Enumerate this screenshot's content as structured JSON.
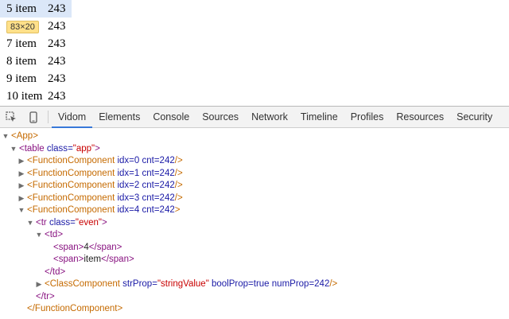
{
  "page": {
    "rows": [
      {
        "label": "5 item",
        "value": "243",
        "highlight": true
      },
      {
        "label": "83×20",
        "value": "243",
        "badge": true
      },
      {
        "label": "7 item",
        "value": "243"
      },
      {
        "label": "8 item",
        "value": "243"
      },
      {
        "label": "9 item",
        "value": "243"
      },
      {
        "label": "10 item",
        "value": "243"
      }
    ]
  },
  "devtools": {
    "tabs": [
      "Vidom",
      "Elements",
      "Console",
      "Sources",
      "Network",
      "Timeline",
      "Profiles",
      "Resources",
      "Security"
    ],
    "active_tab": "Vidom",
    "tree": {
      "app": "App",
      "table_tag": "table",
      "table_class_attr": "class",
      "table_class_val": "\"app\"",
      "func_name": "FunctionComponent",
      "func_rows": [
        {
          "idx": "idx=0",
          "cnt": "cnt=242"
        },
        {
          "idx": "idx=1",
          "cnt": "cnt=242"
        },
        {
          "idx": "idx=2",
          "cnt": "cnt=242"
        },
        {
          "idx": "idx=3",
          "cnt": "cnt=242"
        },
        {
          "idx": "idx=4",
          "cnt": "cnt=242"
        }
      ],
      "tr_tag": "tr",
      "tr_class_attr": "class",
      "tr_class_val": "\"even\"",
      "td_tag": "td",
      "span_tag": "span",
      "span1_text": "4",
      "span2_text": "item",
      "class_comp": "ClassComponent",
      "str_prop_attr": "strProp",
      "str_prop_val": "\"stringValue\"",
      "bool_prop": "boolProp=true",
      "num_prop": "numProp=242"
    }
  }
}
